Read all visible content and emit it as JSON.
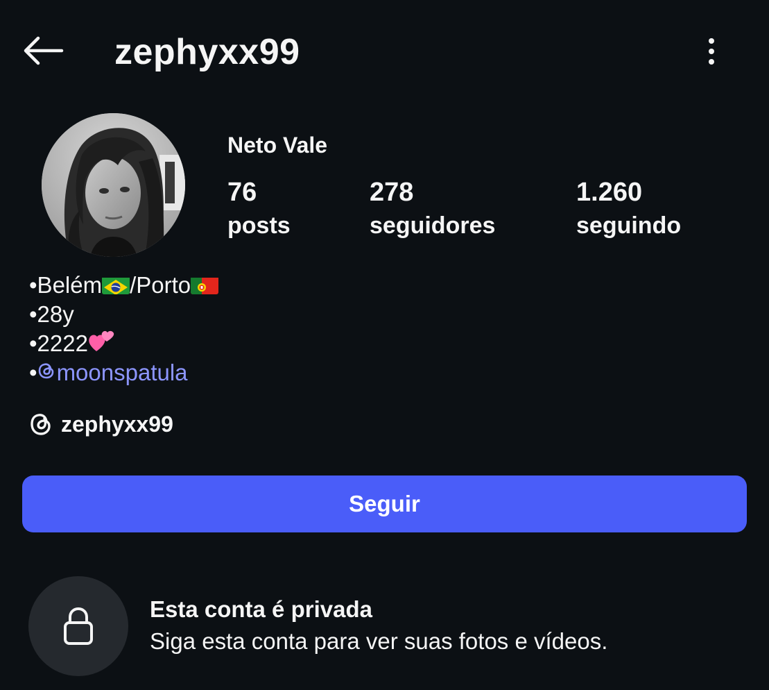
{
  "header": {
    "username": "zephyxx99",
    "back_icon": "arrow-left-icon",
    "more_icon": "more-vertical-icon"
  },
  "profile": {
    "display_name": "Neto Vale",
    "avatar": "profile-photo",
    "stats": [
      {
        "value": "76",
        "label": "posts"
      },
      {
        "value": "278",
        "label": "seguidores"
      },
      {
        "value": "1.260",
        "label": "seguindo"
      }
    ],
    "bio": {
      "line1_city1": "•Belém",
      "line1_sep": "/Porto",
      "line2": "•28y",
      "line3": "•2222",
      "line4_prefix": "•",
      "line4_mention": "moonspatula"
    },
    "threads_handle": "zephyxx99"
  },
  "follow_button": {
    "label": "Seguir"
  },
  "private_notice": {
    "title": "Esta conta é privada",
    "subtitle": "Siga esta conta para ver suas fotos e vídeos.",
    "icon": "lock-icon"
  },
  "colors": {
    "background": "#0c1014",
    "accent": "#4a5df9",
    "mention": "#8c95ff",
    "lock_circle": "#25292e"
  }
}
